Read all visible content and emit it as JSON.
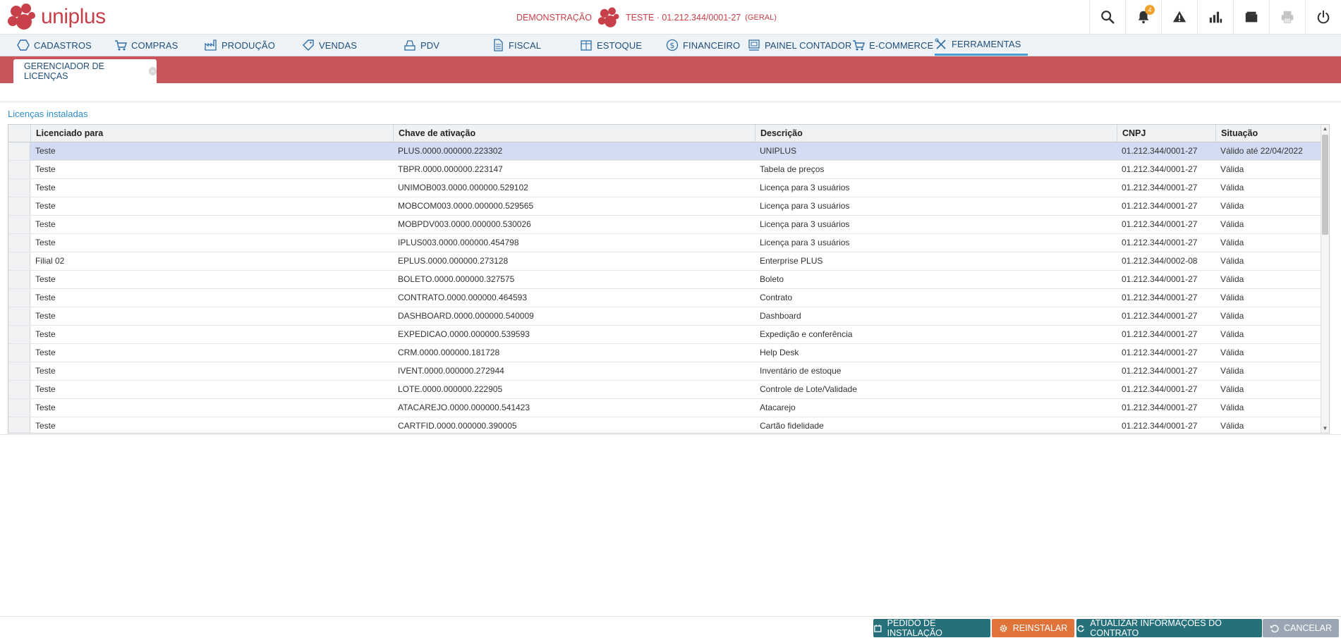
{
  "header": {
    "logo_text": "uniplus",
    "mode_label": "DEMONSTRAÇÃO",
    "company_label": "TESTE · 01.212.344/0001-27",
    "company_scope": "(GERAL)",
    "notification_count": "4",
    "icons": [
      "search-icon",
      "bell-icon",
      "warning-icon",
      "bar-chart-icon",
      "folder-icon",
      "printer-icon",
      "power-icon"
    ]
  },
  "menu": {
    "items": [
      {
        "label": "CADASTROS",
        "icon": "hexagon-icon"
      },
      {
        "label": "COMPRAS",
        "icon": "cart-icon"
      },
      {
        "label": "PRODUÇÃO",
        "icon": "factory-icon"
      },
      {
        "label": "VENDAS",
        "icon": "tag-icon"
      },
      {
        "label": "PDV",
        "icon": "register-icon"
      },
      {
        "label": "FISCAL",
        "icon": "document-icon"
      },
      {
        "label": "ESTOQUE",
        "icon": "box-icon"
      },
      {
        "label": "FINANCEIRO",
        "icon": "dollar-icon"
      },
      {
        "label": "PAINEL CONTADOR",
        "icon": "panel-icon"
      },
      {
        "label": "E-COMMERCE",
        "icon": "cart-icon"
      },
      {
        "label": "FERRAMENTAS",
        "icon": "tools-icon"
      }
    ],
    "active": "FERRAMENTAS"
  },
  "tab": {
    "label": "GERENCIADOR DE LICENÇAS"
  },
  "section_title": "Licenças instaladas",
  "grid": {
    "columns": [
      "Licenciado para",
      "Chave de ativação",
      "Descrição",
      "CNPJ",
      "Situação"
    ],
    "rows": [
      [
        "Teste",
        "PLUS.0000.000000.223302",
        "UNIPLUS",
        "01.212.344/0001-27",
        "Válido até 22/04/2022"
      ],
      [
        "Teste",
        "TBPR.0000.000000.223147",
        "Tabela de preços",
        "01.212.344/0001-27",
        "Válida"
      ],
      [
        "Teste",
        "UNIMOB003.0000.000000.529102",
        "Licença para 3 usuários",
        "01.212.344/0001-27",
        "Válida"
      ],
      [
        "Teste",
        "MOBCOM003.0000.000000.529565",
        "Licença para 3 usuários",
        "01.212.344/0001-27",
        "Válida"
      ],
      [
        "Teste",
        "MOBPDV003.0000.000000.530026",
        "Licença para 3 usuários",
        "01.212.344/0001-27",
        "Válida"
      ],
      [
        "Teste",
        "IPLUS003.0000.000000.454798",
        "Licença para 3 usuários",
        "01.212.344/0001-27",
        "Válida"
      ],
      [
        "Filial 02",
        "EPLUS.0000.000000.273128",
        "Enterprise PLUS",
        "01.212.344/0002-08",
        "Válida"
      ],
      [
        "Teste",
        "BOLETO.0000.000000.327575",
        "Boleto",
        "01.212.344/0001-27",
        "Válida"
      ],
      [
        "Teste",
        "CONTRATO.0000.000000.464593",
        "Contrato",
        "01.212.344/0001-27",
        "Válida"
      ],
      [
        "Teste",
        "DASHBOARD.0000.000000.540009",
        "Dashboard",
        "01.212.344/0001-27",
        "Válida"
      ],
      [
        "Teste",
        "EXPEDICAO.0000.000000.539593",
        "Expedição e conferência",
        "01.212.344/0001-27",
        "Válida"
      ],
      [
        "Teste",
        "CRM.0000.000000.181728",
        "Help Desk",
        "01.212.344/0001-27",
        "Válida"
      ],
      [
        "Teste",
        "IVENT.0000.000000.272944",
        "Inventário de estoque",
        "01.212.344/0001-27",
        "Válida"
      ],
      [
        "Teste",
        "LOTE.0000.000000.222905",
        "Controle de Lote/Validade",
        "01.212.344/0001-27",
        "Válida"
      ],
      [
        "Teste",
        "ATACAREJO.0000.000000.541423",
        "Atacarejo",
        "01.212.344/0001-27",
        "Válida"
      ],
      [
        "Teste",
        "CARTFID.0000.000000.390005",
        "Cartão fidelidade",
        "01.212.344/0001-27",
        "Válida"
      ]
    ]
  },
  "footer": {
    "buttons": [
      {
        "label": "PEDIDO DE INSTALAÇÃO",
        "icon": "calendar-icon",
        "color": "#25707b"
      },
      {
        "label": "REINSTALAR",
        "icon": "gear-icon",
        "color": "#e0733a"
      },
      {
        "label": "ATUALIZAR INFORMAÇÕES DO CONTRATO",
        "icon": "refresh-icon",
        "color": "#25707b"
      },
      {
        "label": "CANCELAR",
        "icon": "undo-icon",
        "color": "#9aa6b4"
      }
    ]
  },
  "colors": {
    "brand_red": "#c8414a",
    "tabstrip": "#c9555a",
    "menu_text": "#1f4e79",
    "selected_row": "#d3dcf2",
    "link_blue": "#2e8ecb"
  }
}
